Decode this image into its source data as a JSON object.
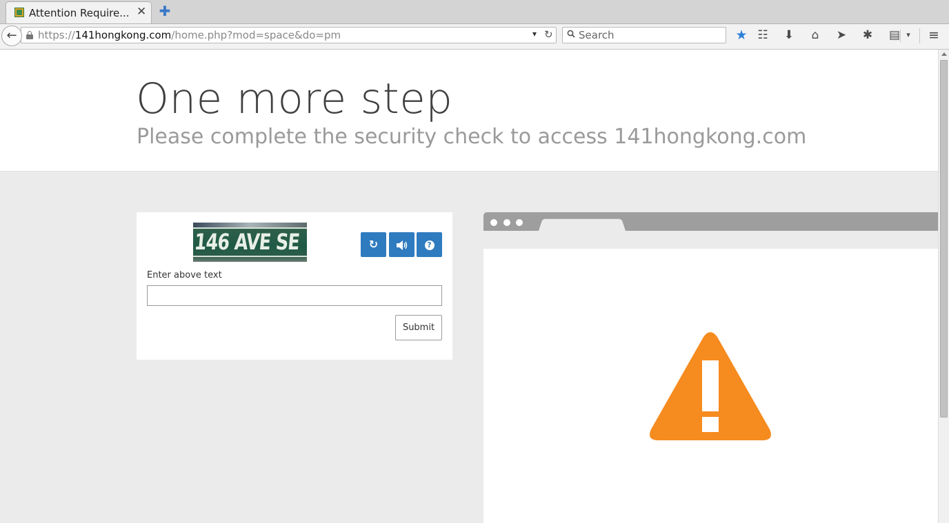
{
  "browser": {
    "tab_title": "Attention Require...",
    "tab_close": "✕",
    "new_tab": "✚",
    "back": "←",
    "url_prefix": "https://",
    "url_domain": "141hongkong.com",
    "url_path": "/home.php?mod=space&do=pm",
    "url_dropdown": "▾",
    "url_reload": "↻",
    "search_placeholder": "Search",
    "toolbar_icons": {
      "bookmark": "★",
      "reading_list": "☷",
      "downloads": "⬇",
      "home": "⌂",
      "send": "➤",
      "extension": "✱",
      "clipboard": "▤",
      "clipboard_dropdown": "▾",
      "menu": "≡"
    },
    "accent_color": "#2b7fd9"
  },
  "page": {
    "title": "One more step",
    "subtitle": "Please complete the security check to access 141hongkong.com",
    "captcha": {
      "image_text": "146 AVE SE",
      "refresh_icon": "↻",
      "audio_icon": "🔊",
      "help_icon": "?",
      "label": "Enter above text",
      "input_value": "",
      "submit_label": "Submit",
      "button_color": "#2f7bbf"
    },
    "warning_color": "#f68b1f"
  }
}
